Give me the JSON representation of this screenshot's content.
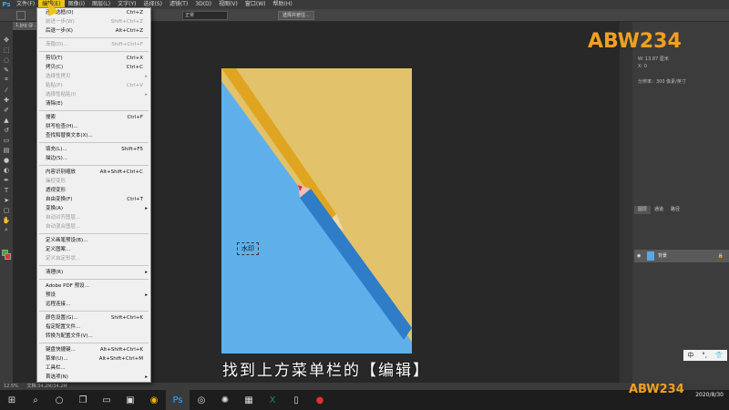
{
  "app": {
    "logo_text": "Ps",
    "menus": [
      "文件(F)",
      "编辑(E)",
      "图像(I)",
      "图层(L)",
      "文字(Y)",
      "选择(S)",
      "滤镜(T)",
      "3D(D)",
      "视图(V)",
      "窗口(W)",
      "帮助(H)"
    ],
    "active_menu_index": 1
  },
  "options_bar": {
    "mode_value": "正常",
    "select_subject_label": "选择并遮住..."
  },
  "document": {
    "tab_label": "1.jpg @ ...",
    "zoom": "12.5%",
    "status": "文档:34.2M/34.2M"
  },
  "edit_menu": {
    "items": [
      {
        "label": "还原选框(O)",
        "shortcut": "Ctrl+Z",
        "disabled": false,
        "submenu": false
      },
      {
        "label": "前进一步(W)",
        "shortcut": "Shift+Ctrl+Z",
        "disabled": true,
        "submenu": false
      },
      {
        "label": "后退一步(K)",
        "shortcut": "Alt+Ctrl+Z",
        "disabled": false,
        "submenu": false
      },
      {
        "sep": true
      },
      {
        "label": "渐隐(D)...",
        "shortcut": "Shift+Ctrl+F",
        "disabled": true,
        "submenu": false
      },
      {
        "sep": true
      },
      {
        "label": "剪切(T)",
        "shortcut": "Ctrl+X",
        "disabled": false,
        "submenu": false
      },
      {
        "label": "拷贝(C)",
        "shortcut": "Ctrl+C",
        "disabled": false,
        "submenu": false
      },
      {
        "label": "选择性拷贝",
        "shortcut": "",
        "disabled": true,
        "submenu": true
      },
      {
        "label": "粘贴(P)",
        "shortcut": "Ctrl+V",
        "disabled": true,
        "submenu": false
      },
      {
        "label": "选择性粘贴(I)",
        "shortcut": "",
        "disabled": true,
        "submenu": true
      },
      {
        "label": "清除(E)",
        "shortcut": "",
        "disabled": false,
        "submenu": false
      },
      {
        "sep": true
      },
      {
        "label": "搜索",
        "shortcut": "Ctrl+F",
        "disabled": false,
        "submenu": false
      },
      {
        "label": "拼写检查(H)...",
        "shortcut": "",
        "disabled": false,
        "submenu": false
      },
      {
        "label": "查找和替换文本(X)...",
        "shortcut": "",
        "disabled": false,
        "submenu": false
      },
      {
        "sep": true
      },
      {
        "label": "填充(L)...",
        "shortcut": "Shift+F5",
        "disabled": false,
        "submenu": false
      },
      {
        "label": "描边(S)...",
        "shortcut": "",
        "disabled": false,
        "submenu": false
      },
      {
        "sep": true
      },
      {
        "label": "内容识别缩放",
        "shortcut": "Alt+Shift+Ctrl+C",
        "disabled": false,
        "submenu": false
      },
      {
        "label": "操控变形",
        "shortcut": "",
        "disabled": true,
        "submenu": false
      },
      {
        "label": "透视变形",
        "shortcut": "",
        "disabled": false,
        "submenu": false
      },
      {
        "label": "自由变换(F)",
        "shortcut": "Ctrl+T",
        "disabled": false,
        "submenu": false
      },
      {
        "label": "变换(A)",
        "shortcut": "",
        "disabled": false,
        "submenu": true
      },
      {
        "label": "自动对齐图层...",
        "shortcut": "",
        "disabled": true,
        "submenu": false
      },
      {
        "label": "自动混合图层...",
        "shortcut": "",
        "disabled": true,
        "submenu": false
      },
      {
        "sep": true
      },
      {
        "label": "定义画笔预设(B)...",
        "shortcut": "",
        "disabled": false,
        "submenu": false
      },
      {
        "label": "定义图案...",
        "shortcut": "",
        "disabled": false,
        "submenu": false
      },
      {
        "label": "定义自定形状...",
        "shortcut": "",
        "disabled": true,
        "submenu": false
      },
      {
        "sep": true
      },
      {
        "label": "清理(R)",
        "shortcut": "",
        "disabled": false,
        "submenu": true
      },
      {
        "sep": true
      },
      {
        "label": "Adobe PDF 预设...",
        "shortcut": "",
        "disabled": false,
        "submenu": false
      },
      {
        "label": "预设",
        "shortcut": "",
        "disabled": false,
        "submenu": true
      },
      {
        "label": "远程连接...",
        "shortcut": "",
        "disabled": false,
        "submenu": false
      },
      {
        "sep": true
      },
      {
        "label": "颜色设置(G)...",
        "shortcut": "Shift+Ctrl+K",
        "disabled": false,
        "submenu": false
      },
      {
        "label": "指定配置文件...",
        "shortcut": "",
        "disabled": false,
        "submenu": false
      },
      {
        "label": "转换为配置文件(V)...",
        "shortcut": "",
        "disabled": false,
        "submenu": false
      },
      {
        "sep": true
      },
      {
        "label": "键盘快捷键...",
        "shortcut": "Alt+Shift+Ctrl+K",
        "disabled": false,
        "submenu": false
      },
      {
        "label": "菜单(U)...",
        "shortcut": "Alt+Shift+Ctrl+M",
        "disabled": false,
        "submenu": false
      },
      {
        "label": "工具栏...",
        "shortcut": "",
        "disabled": false,
        "submenu": false
      },
      {
        "label": "首选项(N)",
        "shortcut": "",
        "disabled": false,
        "submenu": true
      }
    ]
  },
  "canvas": {
    "watermark_text": "水印"
  },
  "subtitle": "找到上方菜单栏的【编辑】",
  "properties": {
    "width_label": "W: 13.87 厘米",
    "x_label": "X: 0",
    "resolution_text": "分辨率：300 像素/英寸"
  },
  "layers_panel": {
    "tabs": [
      "图层",
      "通道",
      "路径"
    ],
    "layer_name": "背景"
  },
  "ime": {
    "items": [
      "中",
      "°,",
      "👕"
    ]
  },
  "taskbar": {
    "time": "",
    "date": "2020/8/30",
    "icons": [
      "windows-icon",
      "search-icon",
      "cortana-icon",
      "taskview-icon",
      "explorer-icon",
      "store-icon",
      "chrome-icon",
      "photoshop-icon",
      "cinema4d-icon",
      "blender-icon",
      "app-icon",
      "excel-icon",
      "folder-icon",
      "record-icon"
    ]
  },
  "brand": {
    "logo_text": "ABW234",
    "accent": "#f0a020"
  }
}
